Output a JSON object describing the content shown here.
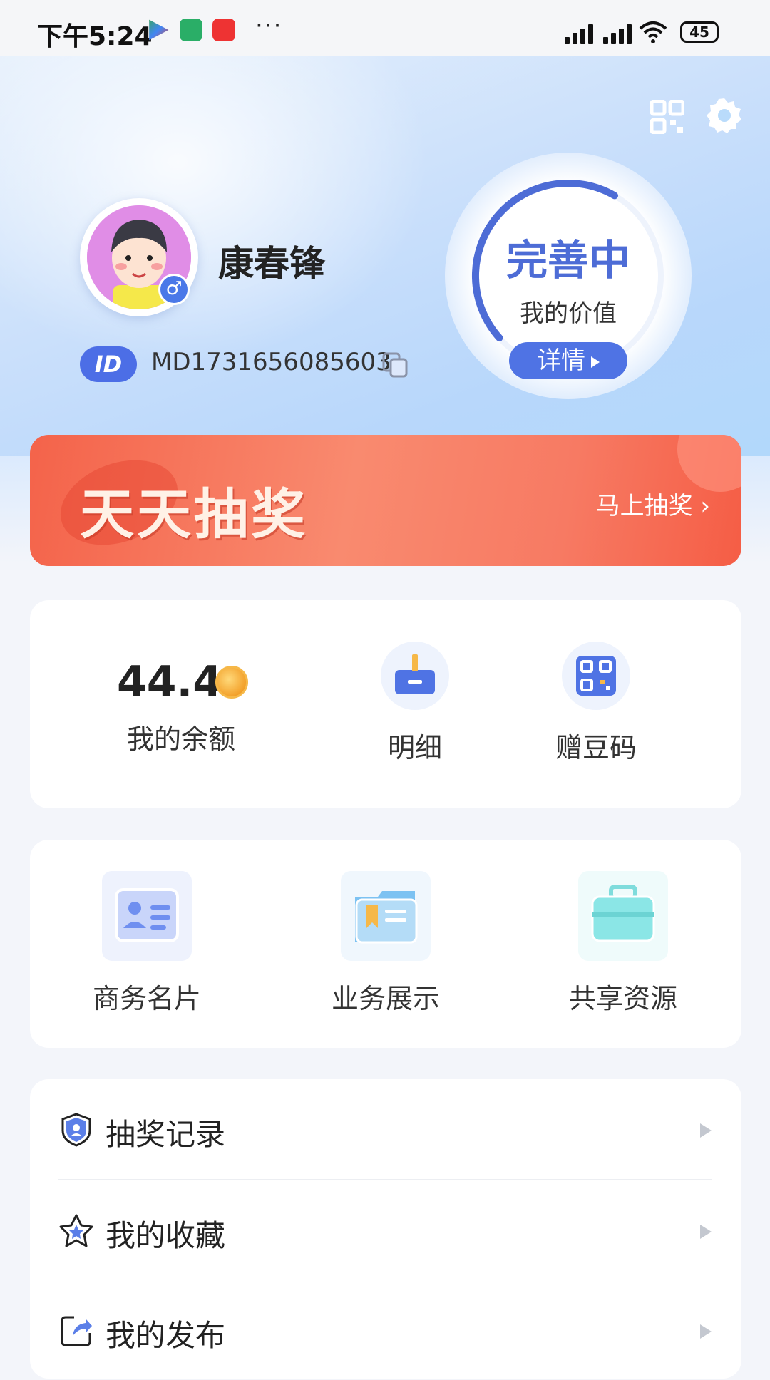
{
  "status_bar": {
    "time": "下午5:24",
    "battery": "45"
  },
  "profile": {
    "name": "康春锋",
    "id_label": "ID",
    "id_value": "MD1731656085603"
  },
  "value_ring": {
    "status": "完善中",
    "label": "我的价值",
    "detail_button": "详情",
    "progress": 0.3
  },
  "banner": {
    "title": "天天抽奖",
    "cta": "马上抽奖 ›"
  },
  "wallet": {
    "balance": "44.4",
    "balance_label": "我的余额",
    "detail_label": "明细",
    "gift_code_label": "赠豆码"
  },
  "services": [
    {
      "label": "商务名片"
    },
    {
      "label": "业务展示"
    },
    {
      "label": "共享资源"
    }
  ],
  "menu": [
    {
      "label": "抽奖记录"
    },
    {
      "label": "我的收藏"
    },
    {
      "label": "我的发布"
    }
  ],
  "colors": {
    "accent": "#4f73e4",
    "banner": "#f4634a",
    "background": "#f3f5fa"
  }
}
